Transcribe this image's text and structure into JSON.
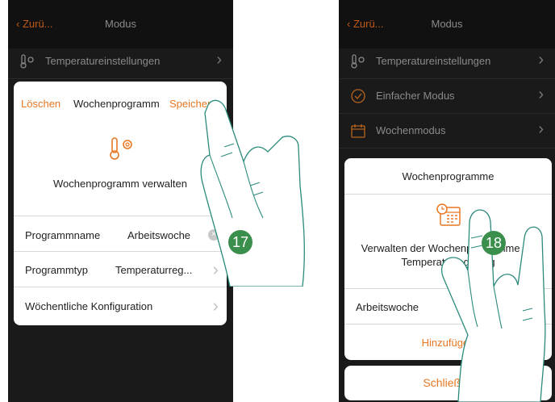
{
  "left_screen": {
    "header": {
      "back_label": "Zurü...",
      "title": "Modus"
    },
    "rows": [
      {
        "label": "Temperatureinstellungen"
      }
    ],
    "dialog": {
      "delete_label": "Löschen",
      "title": "Wochenprogramm",
      "save_label": "Speichern",
      "description": "Wochenprogramm verwalten",
      "fields": [
        {
          "label": "Programmname",
          "value": "Arbeitswoche"
        },
        {
          "label": "Programmtyp",
          "value": "Temperaturreg..."
        },
        {
          "label": "Wöchentliche Konfiguration",
          "value": ""
        }
      ]
    },
    "step_badge": "17"
  },
  "right_screen": {
    "header": {
      "back_label": "Zurü...",
      "title": "Modus"
    },
    "rows": [
      {
        "label": "Temperatureinstellungen"
      },
      {
        "label": "Einfacher Modus"
      },
      {
        "label": "Wochenmodus"
      }
    ],
    "dialog": {
      "title": "Wochenprogramme",
      "description": "Verwalten der Wochenprogramme für Temperaturregelung",
      "program_item": "Arbeitswoche",
      "add_label": "Hinzufügen",
      "close_label": "Schließen"
    },
    "step_badge": "18"
  },
  "colors": {
    "accent": "#e87722",
    "badge": "#3a8f4d",
    "dark_bg": "#1a1a1a"
  }
}
